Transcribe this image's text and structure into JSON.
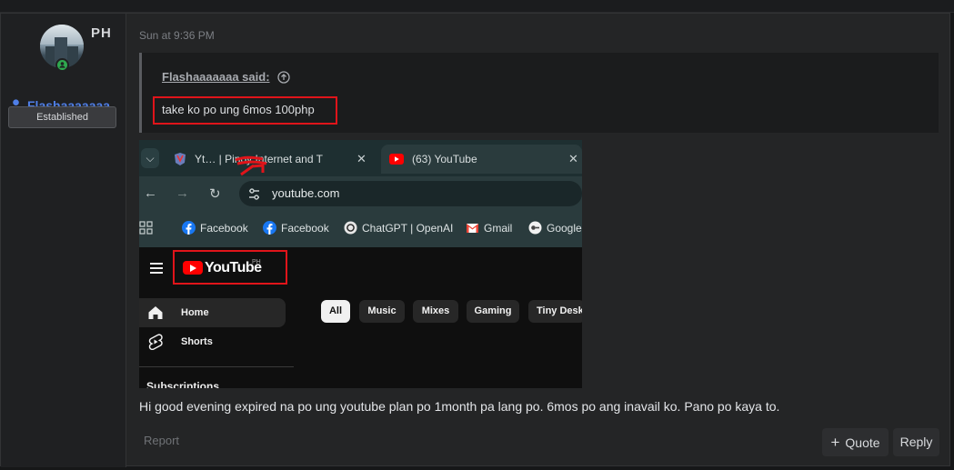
{
  "user": {
    "flag_label": "PH",
    "username": "Flashaaaaaaa",
    "rank_badge": "Established"
  },
  "post": {
    "timestamp": "Sun at 9:36 PM",
    "quote": {
      "author": "Flashaaaaaaa said:",
      "text": "take ko po ung 6mos 100php"
    },
    "screenshot": {
      "tabs": [
        {
          "title": "Yt… | Pinoy Internet and T",
          "close": "✕"
        },
        {
          "title": "(63) YouTube",
          "close": "✕"
        }
      ],
      "url": "youtube.com",
      "bookmarks": [
        "Facebook",
        "Facebook",
        "ChatGPT | OpenAI",
        "Gmail",
        "Google"
      ],
      "youtube": {
        "logo_text": "YouTube",
        "region": "PH",
        "sidebar": [
          "Home",
          "Shorts"
        ],
        "subscriptions_heading": "Subscriptions",
        "chips": [
          "All",
          "Music",
          "Mixes",
          "Gaming",
          "Tiny Desk"
        ]
      }
    },
    "body": "Hi good evening expired na po ung youtube plan po 1month pa lang po. 6mos po ang inavail ko. Pano po kaya to.",
    "actions": {
      "report": "Report",
      "quote": "Quote",
      "quote_icon": "+",
      "reply": "Reply"
    }
  },
  "colors": {
    "username": "#4f7fe8",
    "highlight_box": "#e0141a",
    "youtube_red": "#ff0000"
  }
}
